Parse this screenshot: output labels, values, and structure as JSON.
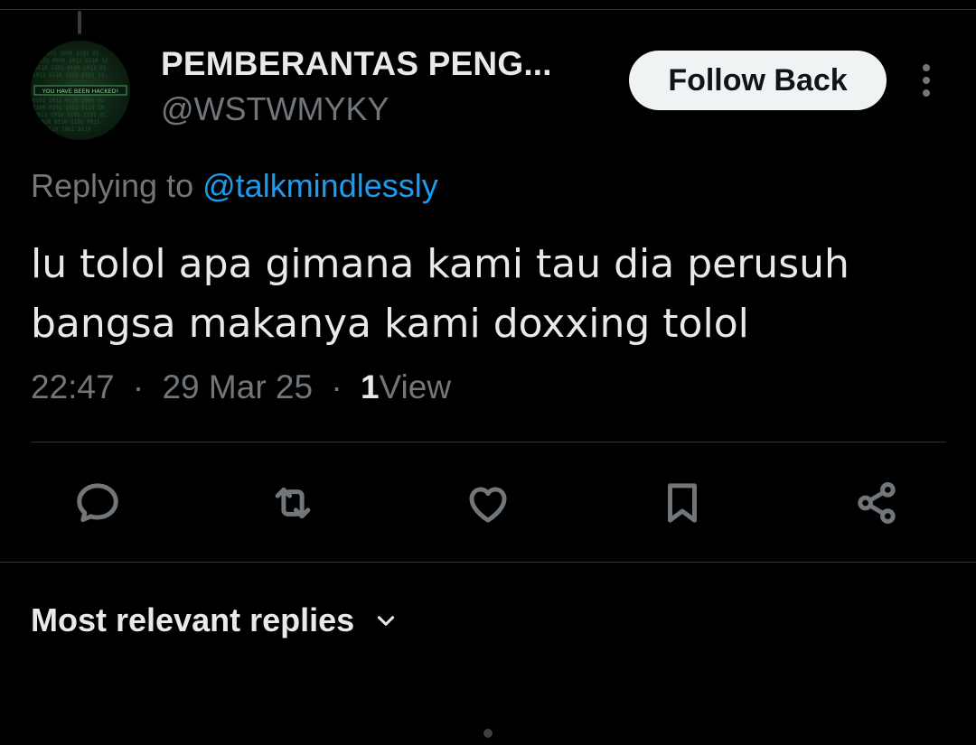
{
  "author": {
    "display_name": "PEMBERANTAS PENG...",
    "handle": "@WSTWMYKY",
    "avatar_text": "YOU HAVE BEEN HACKED!"
  },
  "follow_button": {
    "label": "Follow Back"
  },
  "reply_context": {
    "prefix": "Replying to",
    "mention": "@talkmindlessly"
  },
  "tweet": {
    "lines": [
      "lu tolol apa gimana kami tau dia perusuh",
      "bangsa makanya kami doxxing tolol"
    ],
    "time": "22:47",
    "date": "29 Mar 25",
    "view_count": "1",
    "view_label": "View",
    "separator": "·"
  },
  "actions": {
    "icons": [
      "reply-icon",
      "retweet-icon",
      "like-icon",
      "bookmark-icon",
      "share-icon"
    ]
  },
  "replies_sort": {
    "label": "Most relevant replies"
  },
  "colors": {
    "background": "#000000",
    "text_primary": "#e7e9ea",
    "text_secondary": "#71767b",
    "accent_link": "#1d9bf0",
    "button_bg": "#eff3f4",
    "divider": "#2f3336"
  }
}
